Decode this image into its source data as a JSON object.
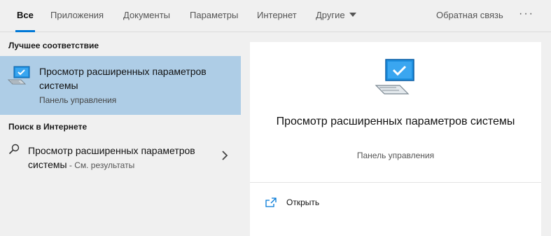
{
  "tabs": {
    "all": "Все",
    "apps": "Приложения",
    "documents": "Документы",
    "settings": "Параметры",
    "internet": "Интернет",
    "other": "Другие",
    "feedback": "Обратная связь",
    "more": "···"
  },
  "left": {
    "best_match_header": "Лучшее соответствие",
    "best_match": {
      "title": "Просмотр расширенных параметров системы",
      "subtitle": "Панель управления",
      "icon": "computer-check-icon"
    },
    "web_header": "Поиск в Интернете",
    "web_result": {
      "title": "Просмотр расширенных параметров системы",
      "suffix": " - См. результаты",
      "icon": "search-icon"
    }
  },
  "right": {
    "title": "Просмотр расширенных параметров системы",
    "subtitle": "Панель управления",
    "actions": {
      "open": "Открыть"
    }
  },
  "colors": {
    "accent": "#0078d7",
    "selection": "#aecde6",
    "background": "#f0f0f0"
  }
}
